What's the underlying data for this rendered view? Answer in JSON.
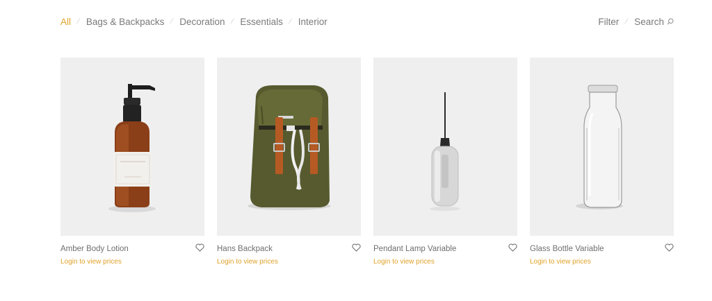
{
  "categories": [
    "All",
    "Bags & Backpacks",
    "Decoration",
    "Essentials",
    "Interior"
  ],
  "tools": {
    "filter": "Filter",
    "search": "Search"
  },
  "accent_color": "#e0a229",
  "products": [
    {
      "name": "Amber Body Lotion",
      "price_text": "Login to view prices",
      "icon": "amber-lotion-bottle"
    },
    {
      "name": "Hans Backpack",
      "price_text": "Login to view prices",
      "icon": "olive-backpack"
    },
    {
      "name": "Pendant Lamp Variable",
      "price_text": "Login to view prices",
      "icon": "pendant-lamp"
    },
    {
      "name": "Glass Bottle Variable",
      "price_text": "Login to view prices",
      "icon": "glass-bottle"
    }
  ]
}
